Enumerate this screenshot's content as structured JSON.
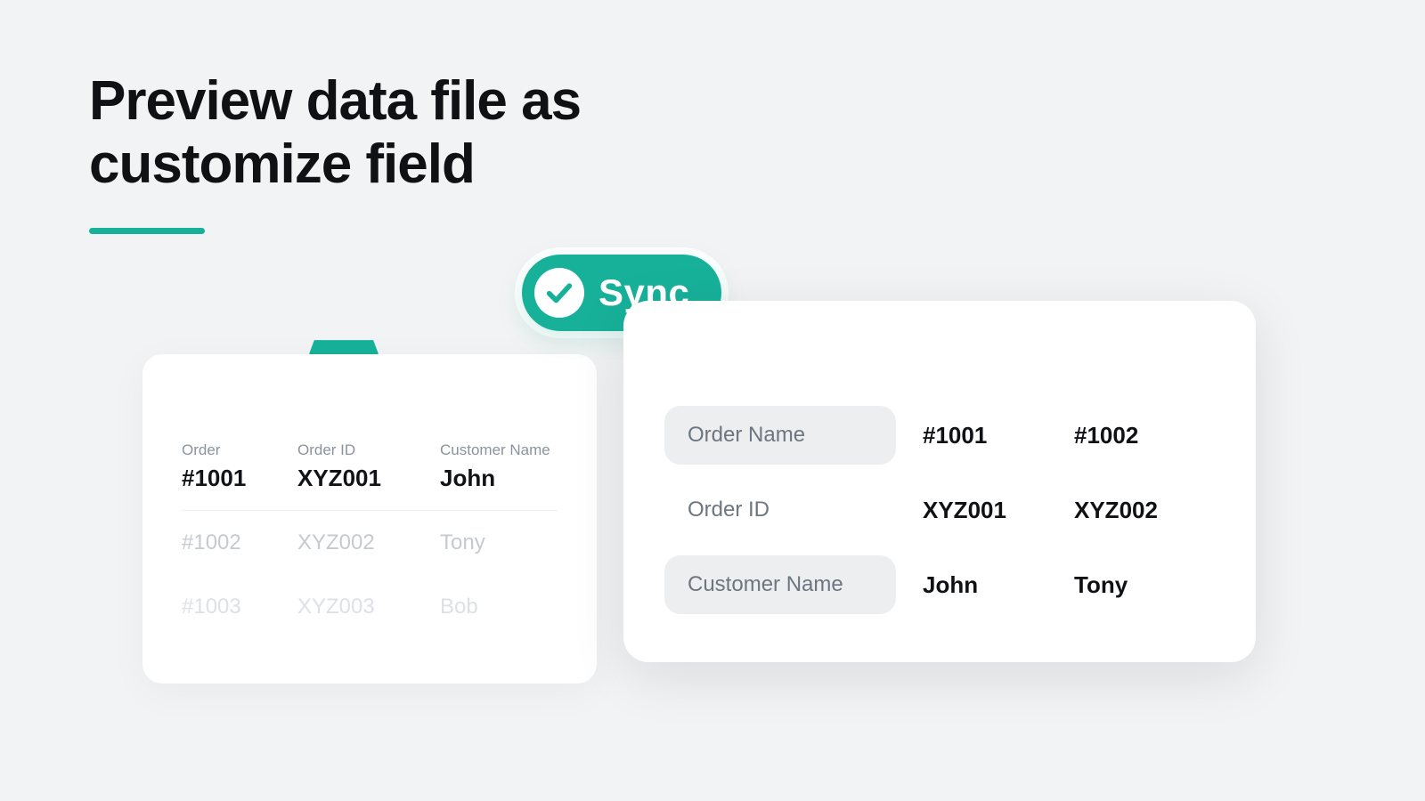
{
  "headline": {
    "line1": "Preview data file as",
    "line2": "customize field"
  },
  "sync": {
    "label": "Sync"
  },
  "source": {
    "columns": [
      "Order",
      "Order ID",
      "Customer Name"
    ],
    "rows": [
      {
        "order": "#1001",
        "id": "XYZ001",
        "name": "John"
      },
      {
        "order": "#1002",
        "id": "XYZ002",
        "name": "Tony"
      },
      {
        "order": "#1003",
        "id": "XYZ003",
        "name": "Bob"
      }
    ]
  },
  "preview": {
    "fields": [
      "Order Name",
      "Order ID",
      "Customer Name"
    ],
    "records": [
      {
        "order_name": "#1001",
        "order_id": "XYZ001",
        "customer": "John"
      },
      {
        "order_name": "#1002",
        "order_id": "XYZ002",
        "customer": "Tony"
      }
    ]
  },
  "colors": {
    "accent": "#17b19a"
  }
}
